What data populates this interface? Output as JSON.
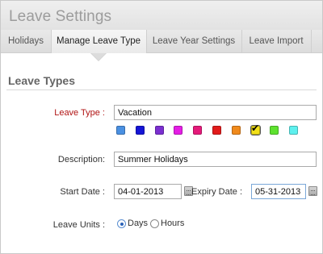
{
  "header": {
    "title": "Leave Settings"
  },
  "tabs": [
    {
      "label": "Holidays"
    },
    {
      "label": "Manage Leave Type"
    },
    {
      "label": "Leave Year Settings"
    },
    {
      "label": "Leave Import"
    }
  ],
  "section": {
    "title": "Leave Types"
  },
  "form": {
    "leave_type": {
      "label": "Leave Type :",
      "value": "Vacation"
    },
    "colors": [
      "#4a90e2",
      "#1515d6",
      "#7b2fd0",
      "#e51ee5",
      "#e51a7a",
      "#e21b1b",
      "#f08a1c",
      "#f2e019",
      "#5ee22f",
      "#5ef0ee"
    ],
    "selected_color": "#f2e019",
    "description": {
      "label": "Description:",
      "value": "Summer Holidays"
    },
    "start_date": {
      "label": "Start Date :",
      "value": "04-01-2013"
    },
    "expiry_date": {
      "label": "Expiry Date :",
      "value": "05-31-2013"
    },
    "leave_units": {
      "label": "Leave Units :",
      "options": [
        "Days",
        "Hours"
      ],
      "selected": "Days"
    }
  }
}
